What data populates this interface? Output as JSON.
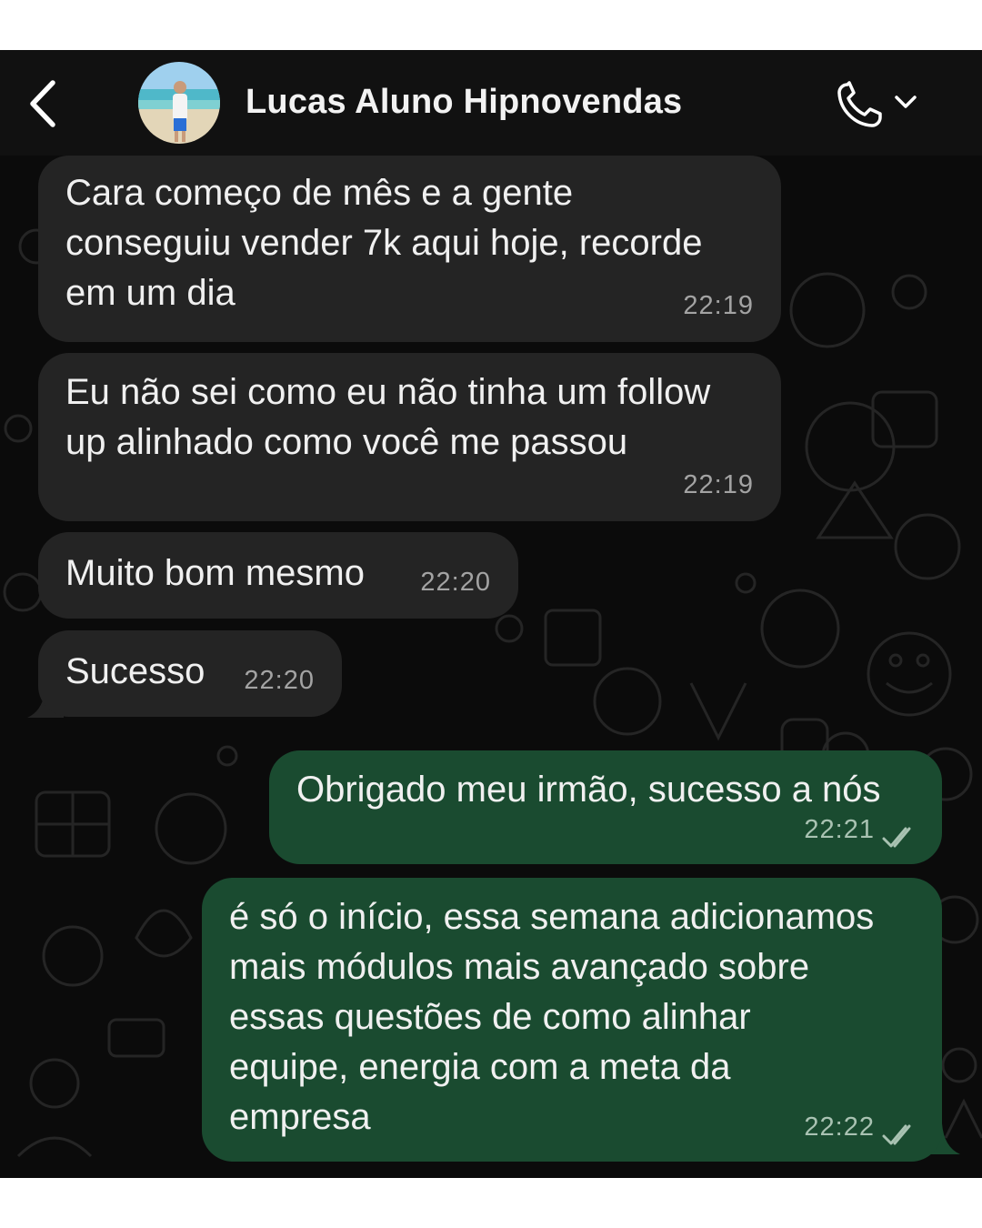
{
  "header": {
    "back_icon": "chevron-left-icon",
    "contact_name": "Lucas Aluno Hipnovendas",
    "call_icon": "phone-icon",
    "call_menu_icon": "chevron-down-icon"
  },
  "colors": {
    "header_bg": "#111111",
    "incoming_bubble": "#242424",
    "outgoing_bubble": "#1a4b30",
    "read_ticks": "#a9c2b2"
  },
  "messages": [
    {
      "direction": "incoming",
      "lines": [
        "Cara começo de mês e a gente",
        "conseguiu vender 7k aqui hoje, recorde",
        "em um dia"
      ],
      "time": "22:19"
    },
    {
      "direction": "incoming",
      "lines": [
        "Eu não sei como eu não tinha um follow",
        "up alinhado como você me passou"
      ],
      "time": "22:19"
    },
    {
      "direction": "incoming",
      "lines": [
        "Muito bom mesmo"
      ],
      "time": "22:20"
    },
    {
      "direction": "incoming",
      "lines": [
        "Sucesso"
      ],
      "time": "22:20"
    },
    {
      "direction": "outgoing",
      "lines": [
        "Obrigado meu irmão, sucesso a nós"
      ],
      "time": "22:21",
      "status_icon": "double-check-icon"
    },
    {
      "direction": "outgoing",
      "lines": [
        "é só o início, essa semana adicionamos",
        "mais módulos mais avançado sobre",
        "essas questões de como alinhar",
        "equipe, energia com a meta da",
        "empresa"
      ],
      "time": "22:22",
      "status_icon": "double-check-icon"
    }
  ]
}
